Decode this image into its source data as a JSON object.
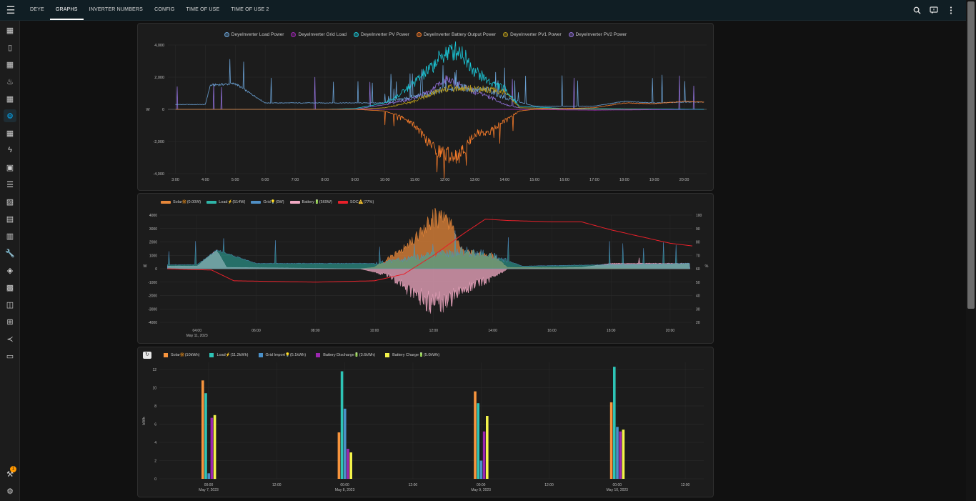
{
  "header": {
    "tabs": [
      {
        "label": "DEYE"
      },
      {
        "label": "GRAPHS",
        "active": true
      },
      {
        "label": "INVERTER NUMBERS"
      },
      {
        "label": "CONFIG"
      },
      {
        "label": "TIME OF USE"
      },
      {
        "label": "TIME OF USE 2"
      }
    ],
    "actions": [
      "search-icon",
      "chat-icon",
      "more-vert-icon"
    ]
  },
  "sidebar": {
    "items": [
      "dashboard-icon",
      "battery-charging-icon",
      "dashboard-icon",
      "thermometer-icon",
      "dashboard-icon",
      "cog-icon",
      "dashboard-icon",
      "lightning-icon",
      "account-box-icon",
      "list-icon",
      "image-icon",
      "calendar-icon",
      "book-icon",
      "wrench-icon",
      "cctv-icon",
      "store-icon",
      "library-icon",
      "sitemap-icon",
      "vscode-icon",
      "terminal-icon"
    ],
    "active_index": 5,
    "bottom": [
      "hammer-icon",
      "settings-icon"
    ],
    "notification_count": "1"
  },
  "colors": {
    "load": "#6aa1d4",
    "grid": "#9c27b0",
    "pv": "#1bc6d6",
    "battery": "#f57b2a",
    "pv1": "#b79a1a",
    "pv2": "#8f6fd6",
    "solar_area": "#e6873a",
    "load_area": "#2fb5a8",
    "grid_area": "#4f8fc5",
    "battery_area": "#f0a8c2",
    "soc": "#e8202a",
    "bar_solar": "#f7943d",
    "bar_load": "#2ec4b6",
    "bar_grid": "#4a90c8",
    "bar_discharge": "#9c27b0",
    "bar_charge": "#f3f34a"
  },
  "chart1": {
    "legend": [
      "DeyeInverter Load Power",
      "DeyeInverter Grid Load",
      "DeyeInverter PV Power",
      "DeyeInverter Battery Output Power",
      "DeyeInverter PV1 Power",
      "DeyeInverter PV2 Power"
    ],
    "ylabel": "W",
    "yticks": [
      "4,000",
      "2,000",
      "0",
      "-2,000",
      "-4,000"
    ],
    "xticks": [
      "3:00",
      "4:00",
      "5:00",
      "6:00",
      "7:00",
      "8:00",
      "9:00",
      "10:00",
      "11:00",
      "12:00",
      "13:00",
      "14:00",
      "15:00",
      "16:00",
      "17:00",
      "18:00",
      "19:00",
      "20:00"
    ]
  },
  "chart2": {
    "legend": [
      {
        "label": "Solar🔆(0.00W)"
      },
      {
        "label": "Load⚡(514W)"
      },
      {
        "label": "Grid💡(0W)"
      },
      {
        "label": "Battery🔋(569W)"
      },
      {
        "label": "SOC⚠️(77%)"
      }
    ],
    "ylabel_left": "W",
    "ylabel_right": "%",
    "yticks_left": [
      "4000",
      "3000",
      "2000",
      "1000",
      "0",
      "-1000",
      "-2000",
      "-3000",
      "-4000"
    ],
    "yticks_right": [
      "100",
      "90",
      "80",
      "70",
      "60",
      "50",
      "40",
      "30",
      "20"
    ],
    "xticks": [
      "04:00",
      "06:00",
      "08:00",
      "10:00",
      "12:00",
      "14:00",
      "16:00",
      "18:00",
      "20:00"
    ],
    "date_label": "May 11, 2023"
  },
  "chart_data": [
    {
      "type": "line",
      "title": "",
      "ylabel": "W",
      "ylim": [
        -4000,
        4000
      ],
      "x_range": [
        "2:45",
        "20:45"
      ],
      "series": [
        {
          "name": "DeyeInverter Load Power",
          "x": [
            "3:00",
            "4:00",
            "4:10",
            "5:00",
            "6:00",
            "8:00",
            "10:00",
            "11:00",
            "11:30",
            "12:00",
            "12:30",
            "13:00",
            "13:30",
            "14:00",
            "15:00",
            "16:00",
            "17:00",
            "18:00",
            "19:00",
            "20:00",
            "20:40"
          ],
          "values": [
            300,
            300,
            1500,
            1600,
            400,
            400,
            400,
            800,
            900,
            1300,
            1400,
            1200,
            1200,
            700,
            200,
            200,
            200,
            500,
            400,
            450,
            450
          ]
        },
        {
          "name": "DeyeInverter Grid Load",
          "x": [
            "3:00",
            "10:00",
            "12:00",
            "13:00",
            "14:00",
            "17:00",
            "20:40"
          ],
          "values": [
            0,
            0,
            0,
            0,
            0,
            -50,
            0
          ]
        },
        {
          "name": "DeyeInverter PV Power",
          "x": [
            "3:00",
            "8:00",
            "9:00",
            "10:00",
            "10:30",
            "11:00",
            "11:30",
            "12:00",
            "12:30",
            "13:00",
            "13:30",
            "14:00",
            "14:30",
            "16:00",
            "20:40"
          ],
          "values": [
            0,
            0,
            50,
            400,
            900,
            1700,
            2500,
            3500,
            3700,
            2400,
            1700,
            1300,
            200,
            50,
            0
          ]
        },
        {
          "name": "DeyeInverter Battery Output Power",
          "x": [
            "3:00",
            "9:00",
            "10:00",
            "10:30",
            "11:00",
            "11:30",
            "12:00",
            "12:30",
            "13:00",
            "13:30",
            "14:00",
            "14:30",
            "15:00",
            "17:00",
            "18:00",
            "19:00",
            "20:00",
            "20:40"
          ],
          "values": [
            0,
            0,
            -100,
            -400,
            -1000,
            -2200,
            -2800,
            -2900,
            -1500,
            -1400,
            -700,
            -100,
            0,
            100,
            400,
            350,
            500,
            450
          ]
        },
        {
          "name": "DeyeInverter PV1 Power",
          "x": [
            "3:00",
            "9:00",
            "10:00",
            "11:00",
            "11:30",
            "12:00",
            "13:00",
            "14:00",
            "14:30",
            "16:00",
            "20:40"
          ],
          "values": [
            0,
            0,
            100,
            500,
            900,
            1300,
            1300,
            1100,
            100,
            20,
            0
          ]
        },
        {
          "name": "DeyeInverter PV2 Power",
          "x": [
            "3:00",
            "9:00",
            "10:00",
            "11:00",
            "11:30",
            "12:00",
            "13:00",
            "13:30",
            "14:00",
            "14:30",
            "16:00",
            "20:40"
          ],
          "values": [
            0,
            0,
            300,
            700,
            1100,
            1900,
            1100,
            800,
            300,
            100,
            30,
            0
          ]
        }
      ]
    },
    {
      "type": "area",
      "title": "",
      "ylabel": "W",
      "ylim": [
        -4000,
        4000
      ],
      "y2label": "%",
      "y2lim": [
        20,
        100
      ],
      "x_range": [
        "02:45",
        "20:45"
      ],
      "series": [
        {
          "name": "Solar🔆(0.00W)",
          "x": [
            "03:00",
            "09:30",
            "10:00",
            "11:00",
            "11:30",
            "12:00",
            "12:30",
            "13:00",
            "14:00",
            "14:30",
            "20:40"
          ],
          "values": [
            0,
            0,
            100,
            1500,
            2600,
            3800,
            3600,
            1300,
            1000,
            100,
            0
          ]
        },
        {
          "name": "Load⚡(514W)",
          "x": [
            "03:00",
            "04:00",
            "04:40",
            "06:00",
            "10:00",
            "12:00",
            "13:00",
            "14:00",
            "15:00",
            "20:40"
          ],
          "values": [
            300,
            300,
            1400,
            400,
            400,
            1000,
            1300,
            1000,
            200,
            400
          ]
        },
        {
          "name": "Grid💡(0W)",
          "x": [
            "03:00",
            "20:40"
          ],
          "values": [
            0,
            0
          ]
        },
        {
          "name": "Battery🔋(569W)",
          "x": [
            "03:00",
            "04:00",
            "04:40",
            "05:00",
            "09:30",
            "10:30",
            "11:00",
            "11:30",
            "12:00",
            "12:30",
            "13:00",
            "14:00",
            "14:30",
            "17:00",
            "18:00",
            "20:40"
          ],
          "values": [
            200,
            200,
            1400,
            100,
            0,
            -500,
            -1300,
            -2000,
            -2700,
            -2400,
            -1500,
            -700,
            0,
            100,
            400,
            400
          ]
        },
        {
          "name": "SOC⚠️(77%)",
          "axis": "right",
          "x": [
            "03:00",
            "04:30",
            "05:15",
            "08:00",
            "10:00",
            "11:00",
            "12:00",
            "13:00",
            "13:45",
            "14:30",
            "16:00",
            "17:00",
            "18:00",
            "19:00",
            "20:00",
            "20:45"
          ],
          "values": [
            60,
            59,
            51,
            50,
            51,
            56,
            70,
            86,
            97,
            96,
            95,
            95,
            89,
            84,
            79,
            77
          ]
        }
      ]
    },
    {
      "type": "bar",
      "title": "",
      "ylabel": "kWh",
      "ylim": [
        0,
        12
      ],
      "categories": [
        "May 7, 2023",
        "May 8, 2023",
        "May 9, 2023",
        "May 10, 2023"
      ],
      "series": [
        {
          "name": "Solar🔆(10kWh)",
          "values": [
            10.8,
            5.1,
            9.6,
            8.4
          ]
        },
        {
          "name": "Load⚡(11.2kWh)",
          "values": [
            9.4,
            11.8,
            8.3,
            12.3
          ]
        },
        {
          "name": "Grid Import💡(5.1kWh)",
          "values": [
            0.6,
            7.7,
            2.0,
            5.7
          ]
        },
        {
          "name": "Battery Discharge🔋(3.6kWh)",
          "values": [
            6.7,
            3.3,
            5.2,
            5.2
          ]
        },
        {
          "name": "Battery Charge🔋(5.0kWh)",
          "values": [
            7.0,
            2.9,
            6.9,
            5.4
          ]
        }
      ]
    }
  ],
  "chart3": {
    "reset_label": "↻",
    "legend": [
      "Solar🔆(10kWh)",
      "Load⚡(11.2kWh)",
      "Grid Import💡(5.1kWh)",
      "Battery Discharge🔋(3.6kWh)",
      "Battery Charge🔋(5.0kWh)"
    ],
    "ylabel": "kWh",
    "yticks": [
      "12",
      "10",
      "8",
      "6",
      "4",
      "2",
      "0"
    ],
    "xticks": [
      "00:00",
      "12:00",
      "00:00",
      "12:00",
      "00:00",
      "12:00",
      "00:00",
      "12:00"
    ],
    "dates": [
      "May 7, 2023",
      "May 8, 2023",
      "May 9, 2023",
      "May 10, 2023"
    ]
  }
}
